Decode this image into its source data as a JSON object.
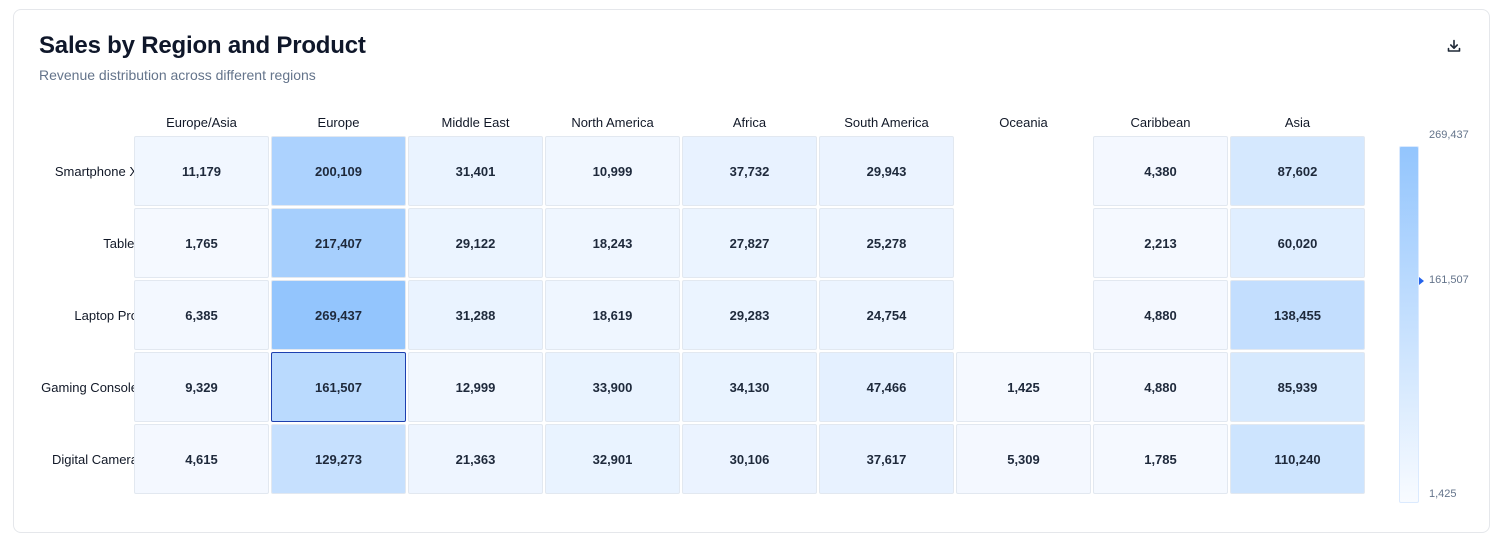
{
  "header": {
    "title": "Sales by Region and Product",
    "subtitle": "Revenue distribution across different regions"
  },
  "icons": {
    "download": "download-icon"
  },
  "colors": {
    "low": "#f5f9ff",
    "high": "#93c5fd",
    "highlight_border": "#1e40af",
    "pointer": "#2563eb"
  },
  "chart_data": {
    "type": "heatmap",
    "title": "Sales by Region and Product",
    "subtitle": "Revenue distribution across different regions",
    "x_categories": [
      "Europe/Asia",
      "Europe",
      "Middle East",
      "North America",
      "Africa",
      "South America",
      "Oceania",
      "Caribbean",
      "Asia"
    ],
    "y_categories": [
      "Smartphone X",
      "Tablet",
      "Laptop Pro",
      "Gaming Console",
      "Digital Camera"
    ],
    "values": [
      [
        11179,
        200109,
        31401,
        10999,
        37732,
        29943,
        null,
        4380,
        87602
      ],
      [
        1765,
        217407,
        29122,
        18243,
        27827,
        25278,
        null,
        2213,
        60020
      ],
      [
        6385,
        269437,
        31288,
        18619,
        29283,
        24754,
        null,
        4880,
        138455
      ],
      [
        9329,
        161507,
        12999,
        33900,
        34130,
        47466,
        1425,
        4880,
        85939
      ],
      [
        4615,
        129273,
        21363,
        32901,
        30106,
        37617,
        5309,
        1785,
        110240
      ]
    ],
    "color_scale": {
      "min": 1425,
      "max": 269437,
      "labels": [
        "269,437",
        "161,507",
        "1,425"
      ],
      "pointer_value": 161507
    },
    "highlighted_cell": {
      "row": 3,
      "col": 1
    }
  }
}
